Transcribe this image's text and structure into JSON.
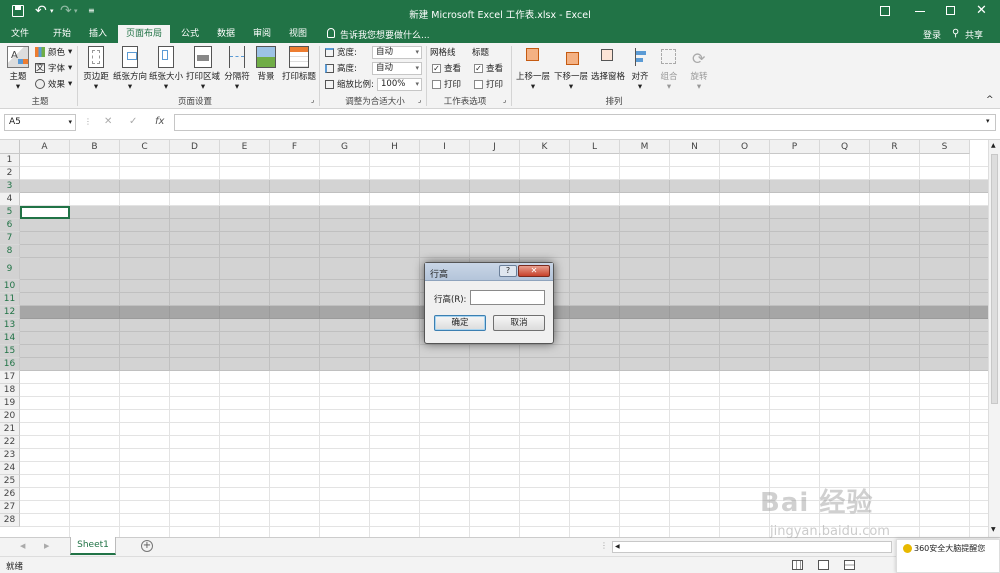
{
  "window": {
    "title": "新建 Microsoft Excel 工作表.xlsx - Excel"
  },
  "ribbon_tabs": [
    {
      "label": "文件"
    },
    {
      "label": "开始"
    },
    {
      "label": "插入"
    },
    {
      "label": "页面布局"
    },
    {
      "label": "公式"
    },
    {
      "label": "数据"
    },
    {
      "label": "审阅"
    },
    {
      "label": "视图"
    }
  ],
  "tellme": "告诉我您想要做什么...",
  "account": {
    "login": "登录",
    "share": "共享"
  },
  "theme_group": {
    "theme": "主题",
    "colors": "颜色",
    "fonts": "字体",
    "effects": "效果",
    "label": "主题"
  },
  "page_setup": {
    "margins": "页边距",
    "orientation": "纸张方向",
    "size": "纸张大小",
    "print_area": "打印区域",
    "breaks": "分隔符",
    "background": "背景",
    "print_titles": "打印标题",
    "label": "页面设置"
  },
  "scale_fit": {
    "width_label": "宽度:",
    "width_value": "自动",
    "height_label": "高度:",
    "height_value": "自动",
    "scale_label": "缩放比例:",
    "scale_value": "100%",
    "label": "调整为合适大小"
  },
  "sheet_options": {
    "gridlines": "网格线",
    "headings": "标题",
    "view": "查看",
    "print": "打印",
    "label": "工作表选项"
  },
  "arrange": {
    "bring_forward": "上移一层",
    "send_backward": "下移一层",
    "selection_pane": "选择窗格",
    "align": "对齐",
    "group": "组合",
    "rotate": "旋转",
    "label": "排列"
  },
  "formula_bar": {
    "name_box": "A5",
    "fx": "fx",
    "value": ""
  },
  "columns": [
    "A",
    "B",
    "C",
    "D",
    "E",
    "F",
    "G",
    "H",
    "I",
    "J",
    "K",
    "L",
    "M",
    "N",
    "O",
    "P",
    "Q",
    "R",
    "S"
  ],
  "rows": [
    "1",
    "2",
    "3",
    "4",
    "5",
    "6",
    "7",
    "8",
    "9",
    "10",
    "11",
    "12",
    "13",
    "14",
    "15",
    "16",
    "17",
    "18",
    "19",
    "20",
    "21",
    "22",
    "23",
    "24",
    "25",
    "26",
    "27",
    "28"
  ],
  "dialog": {
    "title": "行高",
    "help": "?",
    "close": "✕",
    "field_label": "行高(R):",
    "field_value": "",
    "ok": "确定",
    "cancel": "取消"
  },
  "sheets": [
    {
      "name": "Sheet1"
    }
  ],
  "status": {
    "ready": "就绪",
    "popup": "360安全大脑提醒您"
  },
  "watermark": {
    "brand": "Bai 经验",
    "url": "jingyan.baidu.com"
  }
}
